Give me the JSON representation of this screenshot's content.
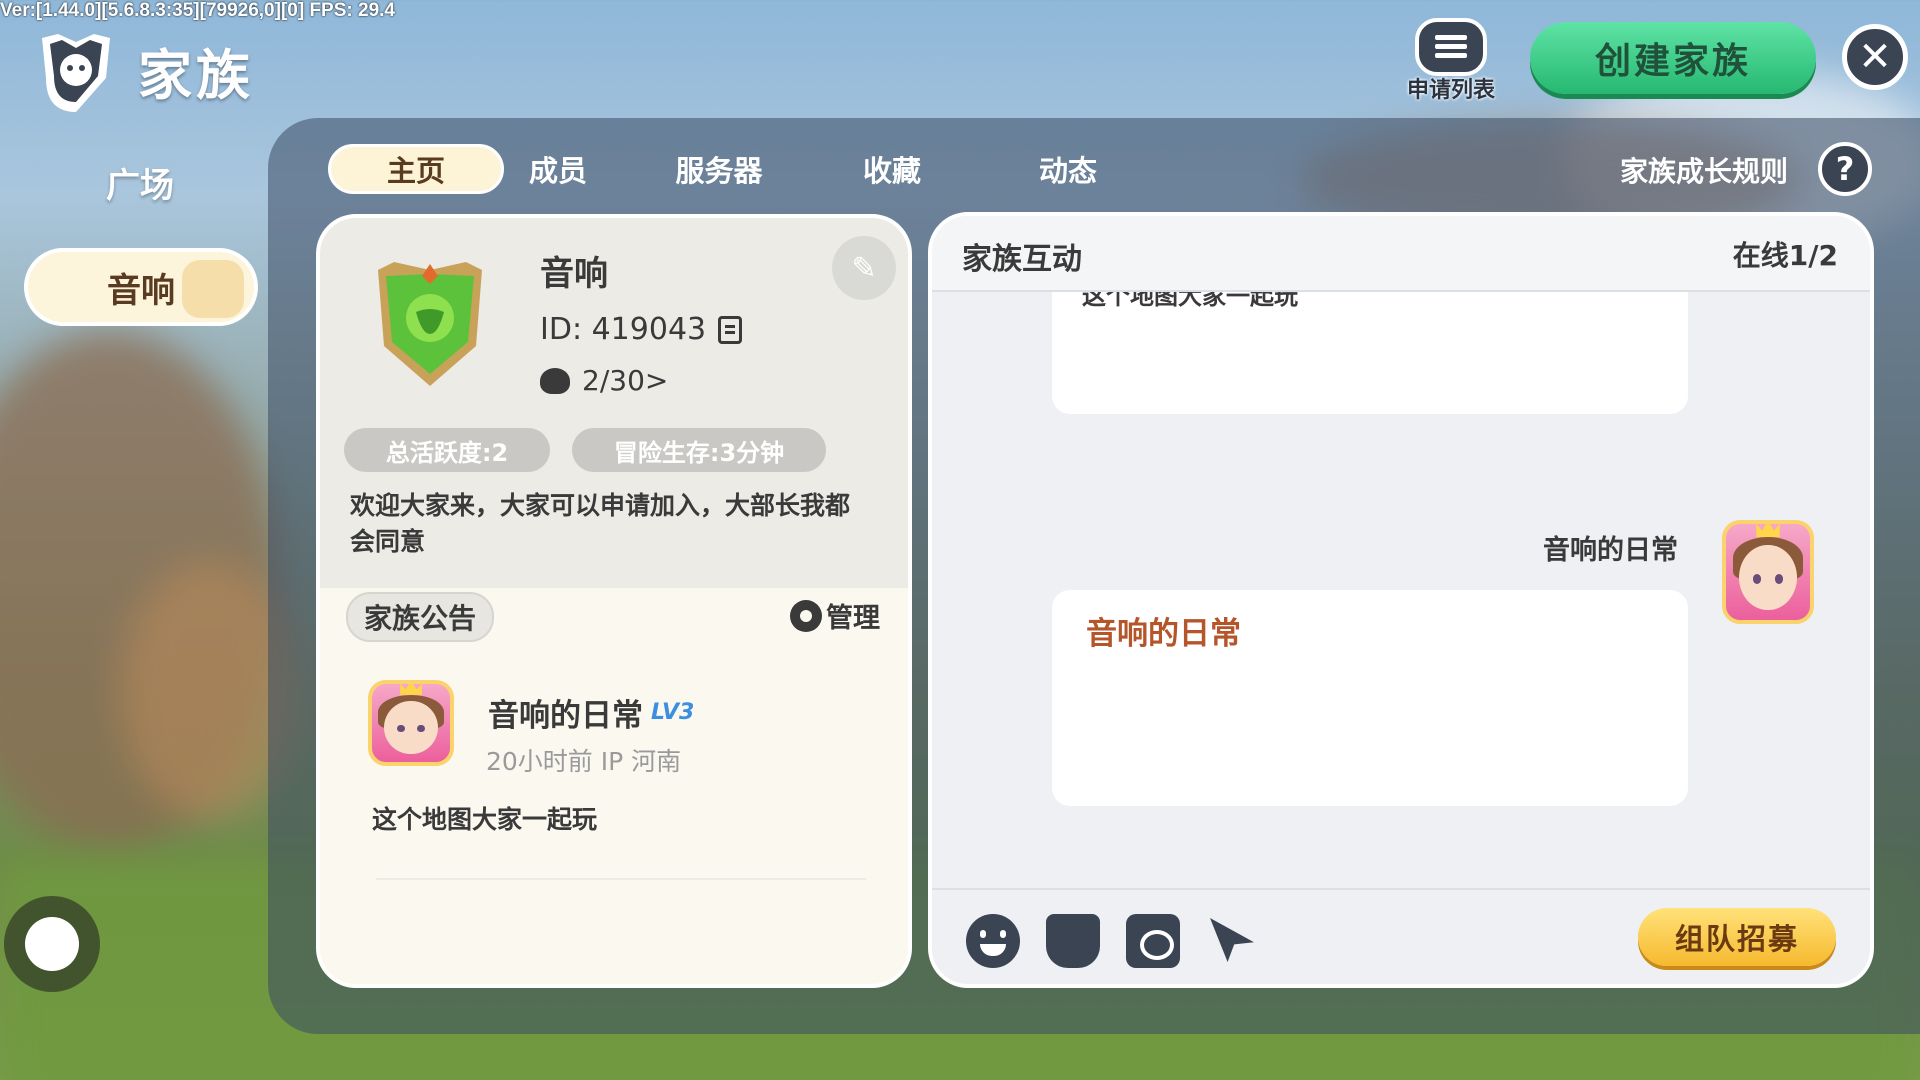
{
  "debug_info": "Ver:[1.44.0][5.6.8.3:35][79926,0][0] FPS: 29.4",
  "header": {
    "title": "家族",
    "apply_list_label": "申请列表",
    "create_button_label": "创建家族"
  },
  "sidebar": {
    "items": [
      {
        "label": "广场",
        "active": false
      },
      {
        "label": "音响",
        "active": true
      }
    ]
  },
  "tabs": [
    {
      "label": "主页",
      "active": true
    },
    {
      "label": "成员",
      "active": false
    },
    {
      "label": "服务器",
      "active": false
    },
    {
      "label": "收藏",
      "active": false
    },
    {
      "label": "动态",
      "active": false
    }
  ],
  "growth_rules_label": "家族成长规则",
  "family": {
    "name": "音响",
    "id_text": "ID: 419043",
    "members_text": "2/30>",
    "total_activity": "总活跃度:2",
    "adventure_survival": "冒险生存:3分钟",
    "welcome": "欢迎大家来，大家可以申请加入，大部长我都会同意"
  },
  "announcement": {
    "title": "家族公告",
    "manage_label": "管理",
    "poster_name": "音响的日常",
    "poster_level": "LV3",
    "meta": "20小时前 IP 河南",
    "text": "这个地图大家一起玩"
  },
  "chat": {
    "title": "家族互动",
    "online": "在线1/2",
    "messages": [
      {
        "text": "这个地图大家一起玩"
      },
      {
        "sender": "音响的日常",
        "text": "音响的日常"
      }
    ],
    "tools": [
      "emoji-icon",
      "gift-icon",
      "box-icon",
      "send-location-icon"
    ],
    "recruit_label": "组队招募"
  },
  "colors": {
    "create_button": "#26b870",
    "recruit_button": "#f6b92e",
    "active_tab": "#fdf3d6",
    "poster_message": "#b4552a",
    "level_badge": "#3b8ee0"
  }
}
